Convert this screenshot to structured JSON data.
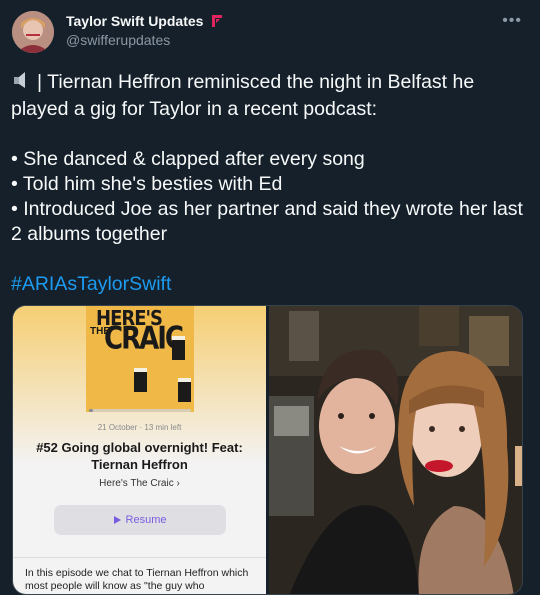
{
  "author": {
    "name": "Taylor Swift Updates",
    "handle": "@swifferupdates"
  },
  "tweet": {
    "intro": "| Tiernan Heffron reminisced the night in Belfast he played a gig for Taylor in a recent podcast:",
    "bullets": [
      "• She danced & clapped after every song",
      "• Told him she's besties with Ed",
      "• Introduced Joe as her partner and said they wrote her last 2 albums together"
    ],
    "hashtag": "#ARIAsTaylorSwift"
  },
  "podcast": {
    "cover_line1": "HERE'S",
    "cover_line2": "THE",
    "cover_line3": "CRAIC",
    "meta": "21 October · 13 min left",
    "episode_title": "#52 Going global overnight! Feat: Tiernan Heffron",
    "show_name": "Here's The Craic",
    "show_chevron": "›",
    "resume_label": "Resume",
    "description": "In this episode we chat to Tiernan Heffron which most people will know as \"the guy who",
    "progress": 0.04
  },
  "colors": {
    "background": "#15202b",
    "hashtag": "#1d9bf0",
    "badge": "#e0245e",
    "resume_accent": "#7a5ce0"
  },
  "icons": [
    "speaker-icon",
    "more-icon",
    "play-icon",
    "verified-badge-icon"
  ]
}
